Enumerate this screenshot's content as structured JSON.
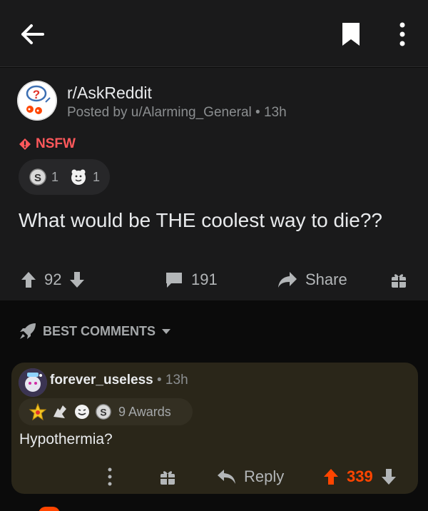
{
  "topbar": {
    "back_icon": "arrow-left-icon",
    "bookmark_icon": "bookmark-icon",
    "menu_icon": "more-vertical-icon"
  },
  "post": {
    "subreddit": "r/AskReddit",
    "posted_by": "Posted by u/Alarming_General • 13h",
    "nsfw_label": "NSFW",
    "awards": [
      {
        "icon": "silver-award-icon",
        "count": "1"
      },
      {
        "icon": "wholesome-award-icon",
        "count": "1"
      }
    ],
    "title": "What would be THE coolest way to die??",
    "score": "92",
    "comments": "191",
    "share_label": "Share"
  },
  "sort": {
    "label": "BEST COMMENTS"
  },
  "comment": {
    "author": "forever_useless",
    "age": "• 13h",
    "awards_label": "9 Awards",
    "body": "Hypothermia?",
    "reply_label": "Reply",
    "score": "339"
  },
  "colors": {
    "upvote": "#ff4500",
    "nsfw": "#ff585b",
    "card": "#1a1a1b",
    "comment_highlight": "#2a2619"
  }
}
